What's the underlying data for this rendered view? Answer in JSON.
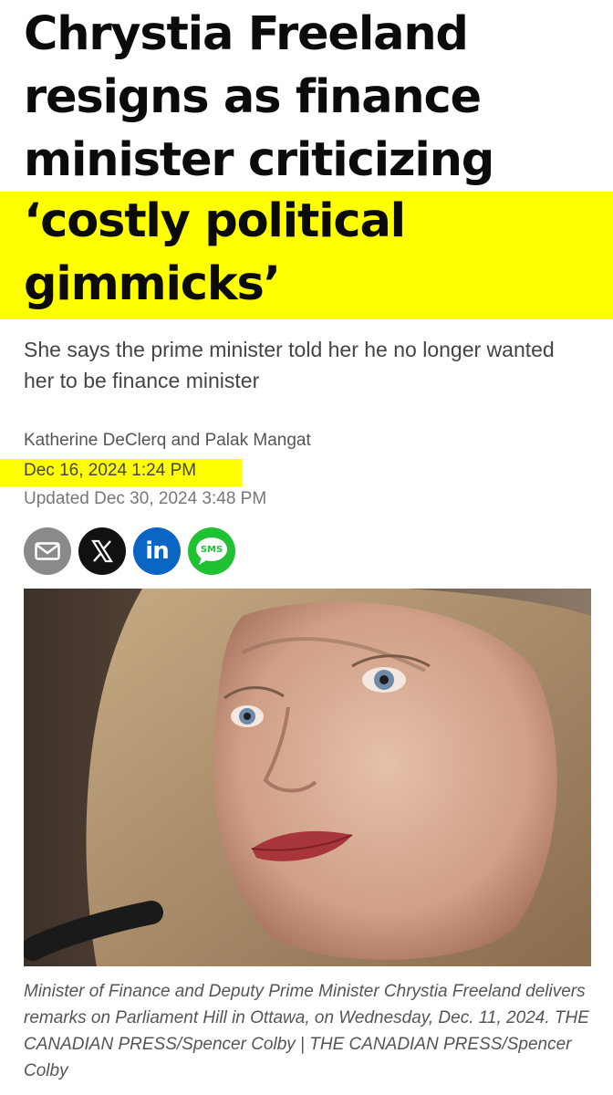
{
  "article": {
    "headline_lines": [
      "Chrystia Freeland",
      "resigns as finance",
      "minister criticizing",
      "‘costly political",
      "gimmicks’"
    ],
    "subheadline": "She says the prime minister told her he no longer wanted her to be finance minister",
    "authors": "Katherine DeClerq and Palak Mangat",
    "published": "Dec 16, 2024 1:24 PM",
    "updated": "Updated Dec 30, 2024 3:48 PM",
    "caption": "Minister of Finance and Deputy Prime Minister Chrystia Freeland delivers remarks on Parliament Hill in Ottawa, on Wednesday, Dec. 11, 2024. THE CANADIAN PRESS/Spencer Colby  |  THE CANADIAN PRESS/Spencer Colby"
  },
  "share": {
    "buttons": [
      {
        "icon": "email-icon",
        "label": ""
      },
      {
        "icon": "x-logo-icon",
        "label": "X"
      },
      {
        "icon": "linkedin-icon",
        "label": "in"
      },
      {
        "icon": "sms-icon",
        "label": "SMS"
      }
    ]
  },
  "colors": {
    "highlight": "#ffff00",
    "email": "#8a8a8a",
    "x": "#111111",
    "linkedin": "#0a66c2",
    "sms": "#1fc232"
  }
}
